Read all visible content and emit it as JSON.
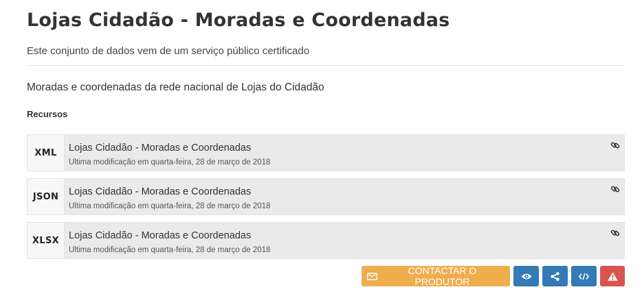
{
  "dataset": {
    "title": "Lojas Cidadão - Moradas e Coordenadas",
    "certification": "Este conjunto de dados vem de um serviço público certificado",
    "description": "Moradas e coordenadas da rede nacional de Lojas do Cidadão"
  },
  "resources": {
    "heading": "Recursos",
    "items": [
      {
        "format": "XML",
        "name": "Lojas Cidadão - Moradas e Coordenadas",
        "modified": "Ultima modificação em quarta-feira, 28 de março de 2018",
        "icon": "link-icon"
      },
      {
        "format": "JSON",
        "name": "Lojas Cidadão - Moradas e Coordenadas",
        "modified": "Ultima modificação em quarta-feira, 28 de março de 2018",
        "icon": "link-icon"
      },
      {
        "format": "XLSX",
        "name": "Lojas Cidadão - Moradas e Coordenadas",
        "modified": "Ultima modificação em quarta-feira, 28 de março de 2018",
        "icon": "link-icon"
      }
    ]
  },
  "actions": {
    "contact_label": "CONTACTAR O PRODUTOR",
    "contact_icon": "envelope-icon",
    "view_icon": "eye-icon",
    "share_icon": "share-icon",
    "embed_icon": "code-icon",
    "report_icon": "warning-icon"
  },
  "colors": {
    "contact": "#f0ad4e",
    "primary": "#337ab7",
    "danger": "#d9534f",
    "resource_bg": "#eaeaea"
  }
}
